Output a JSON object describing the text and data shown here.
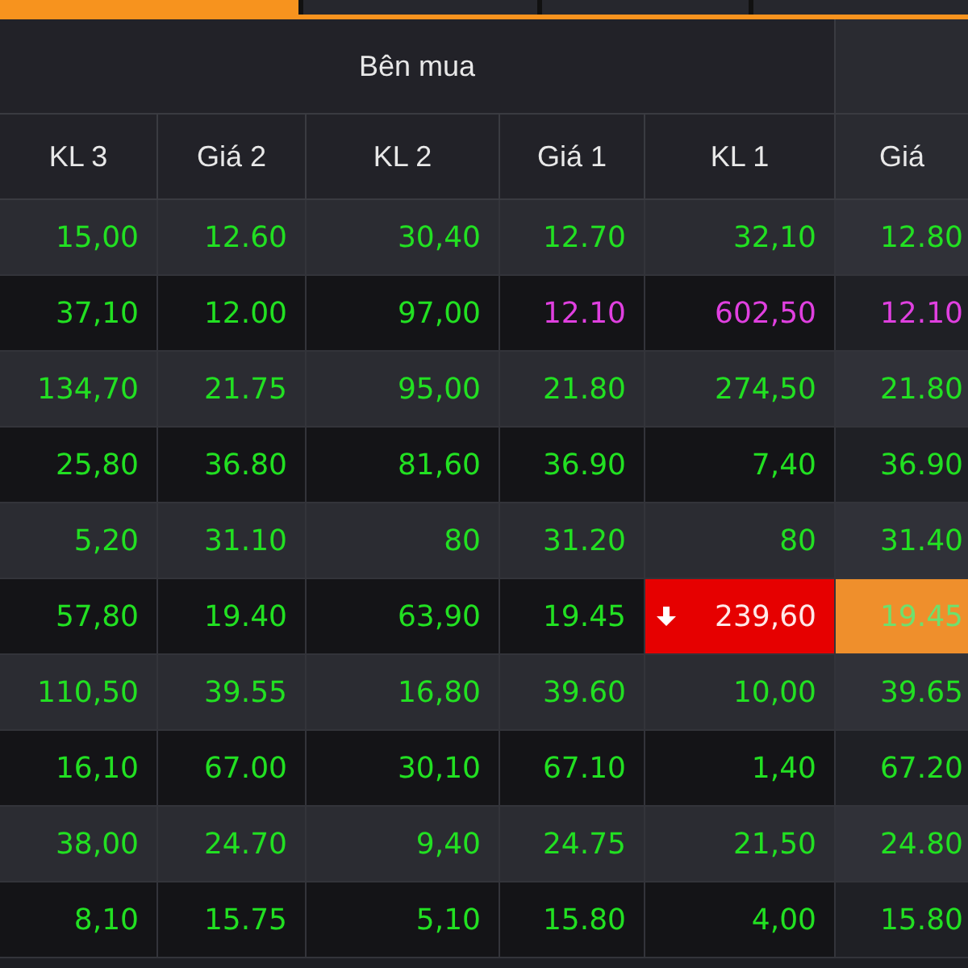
{
  "tabs": [
    {
      "selected": true
    },
    {
      "selected": false
    },
    {
      "selected": false
    },
    {
      "selected": false
    }
  ],
  "group_header": "Bên mua",
  "columns": [
    "KL 3",
    "Giá 2",
    "KL 2",
    "Giá 1",
    "KL 1",
    "Giá"
  ],
  "rows": [
    [
      {
        "text": "15,00",
        "kind": "up"
      },
      {
        "text": "12.60",
        "kind": "up"
      },
      {
        "text": "30,40",
        "kind": "up"
      },
      {
        "text": "12.70",
        "kind": "up"
      },
      {
        "text": "32,10",
        "kind": "up"
      },
      {
        "text": "12.80",
        "kind": "up"
      }
    ],
    [
      {
        "text": "37,10",
        "kind": "up"
      },
      {
        "text": "12.00",
        "kind": "up"
      },
      {
        "text": "97,00",
        "kind": "up"
      },
      {
        "text": "12.10",
        "kind": "ceiling"
      },
      {
        "text": "602,50",
        "kind": "ceiling"
      },
      {
        "text": "12.10",
        "kind": "ceiling"
      }
    ],
    [
      {
        "text": "134,70",
        "kind": "up"
      },
      {
        "text": "21.75",
        "kind": "up"
      },
      {
        "text": "95,00",
        "kind": "up"
      },
      {
        "text": "21.80",
        "kind": "up"
      },
      {
        "text": "274,50",
        "kind": "up"
      },
      {
        "text": "21.80",
        "kind": "up"
      }
    ],
    [
      {
        "text": "25,80",
        "kind": "up"
      },
      {
        "text": "36.80",
        "kind": "up"
      },
      {
        "text": "81,60",
        "kind": "up"
      },
      {
        "text": "36.90",
        "kind": "up"
      },
      {
        "text": "7,40",
        "kind": "up"
      },
      {
        "text": "36.90",
        "kind": "up"
      }
    ],
    [
      {
        "text": "5,20",
        "kind": "up"
      },
      {
        "text": "31.10",
        "kind": "up"
      },
      {
        "text": "80",
        "kind": "up"
      },
      {
        "text": "31.20",
        "kind": "up"
      },
      {
        "text": "80",
        "kind": "up"
      },
      {
        "text": "31.40",
        "kind": "up"
      }
    ],
    [
      {
        "text": "57,80",
        "kind": "up"
      },
      {
        "text": "19.40",
        "kind": "up"
      },
      {
        "text": "63,90",
        "kind": "up"
      },
      {
        "text": "19.45",
        "kind": "up"
      },
      {
        "text": "239,60",
        "kind": "falling"
      },
      {
        "text": "19.45",
        "kind": "changed"
      }
    ],
    [
      {
        "text": "110,50",
        "kind": "up"
      },
      {
        "text": "39.55",
        "kind": "up"
      },
      {
        "text": "16,80",
        "kind": "up"
      },
      {
        "text": "39.60",
        "kind": "up"
      },
      {
        "text": "10,00",
        "kind": "up"
      },
      {
        "text": "39.65",
        "kind": "up"
      }
    ],
    [
      {
        "text": "16,10",
        "kind": "up"
      },
      {
        "text": "67.00",
        "kind": "up"
      },
      {
        "text": "30,10",
        "kind": "up"
      },
      {
        "text": "67.10",
        "kind": "up"
      },
      {
        "text": "1,40",
        "kind": "up"
      },
      {
        "text": "67.20",
        "kind": "up"
      }
    ],
    [
      {
        "text": "38,00",
        "kind": "up"
      },
      {
        "text": "24.70",
        "kind": "up"
      },
      {
        "text": "9,40",
        "kind": "up"
      },
      {
        "text": "24.75",
        "kind": "up"
      },
      {
        "text": "21,50",
        "kind": "up"
      },
      {
        "text": "24.80",
        "kind": "up"
      }
    ],
    [
      {
        "text": "8,10",
        "kind": "up"
      },
      {
        "text": "15.75",
        "kind": "up"
      },
      {
        "text": "5,10",
        "kind": "up"
      },
      {
        "text": "15.80",
        "kind": "up"
      },
      {
        "text": "4,00",
        "kind": "up"
      },
      {
        "text": "15.80",
        "kind": "up"
      }
    ]
  ]
}
